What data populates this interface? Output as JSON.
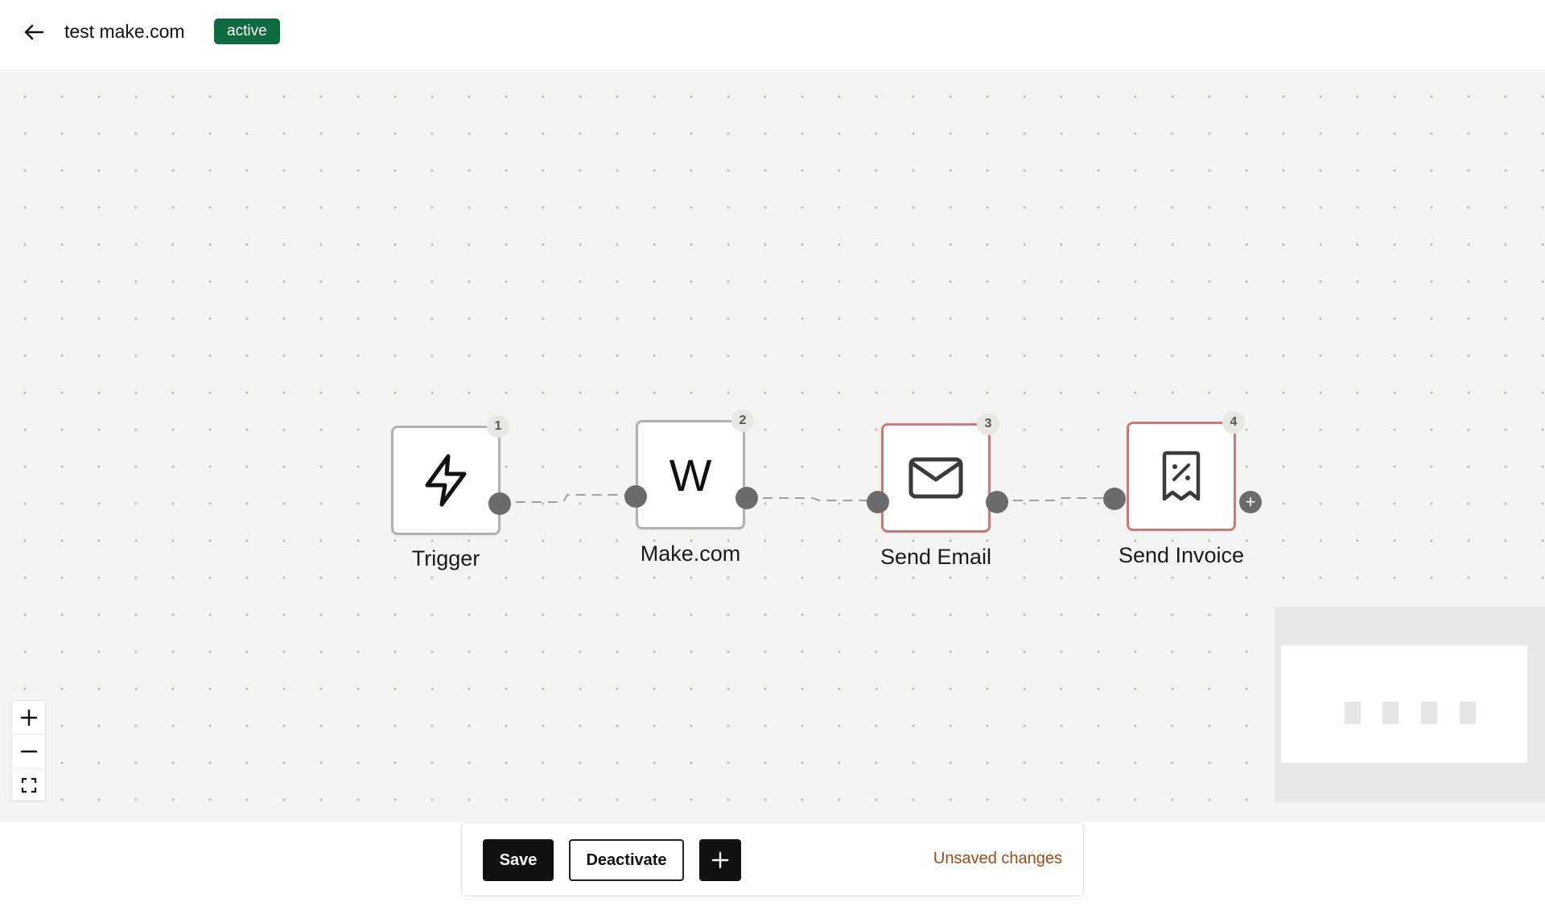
{
  "header": {
    "back_icon": "arrow-left-icon",
    "title": "test make.com",
    "status_badge": "active",
    "badge_color": "#0e6b3e"
  },
  "workflow": {
    "nodes": [
      {
        "number": "1",
        "label": "Trigger",
        "icon": "lightning-icon",
        "state": "normal"
      },
      {
        "number": "2",
        "label": "Make.com",
        "icon": "letter-w",
        "letter": "W",
        "state": "normal"
      },
      {
        "number": "3",
        "label": "Send Email",
        "icon": "mail-icon",
        "state": "error"
      },
      {
        "number": "4",
        "label": "Send Invoice",
        "icon": "receipt-icon",
        "state": "error"
      }
    ],
    "add_step_symbol": "+"
  },
  "zoom_controls": {
    "zoom_in_icon": "plus-icon",
    "zoom_out_icon": "minus-icon",
    "fit_view_icon": "fit-view-icon"
  },
  "toolbar": {
    "save_label": "Save",
    "deactivate_label": "Deactivate",
    "add_icon": "plus-icon",
    "unsaved_label": "Unsaved changes",
    "unsaved_color": "#9a4a1d"
  },
  "colors": {
    "canvas_bg": "#f5f4f2",
    "node_border": "#b3b1ad",
    "node_error_border": "#c97976",
    "handle": "#6d6a6b"
  }
}
